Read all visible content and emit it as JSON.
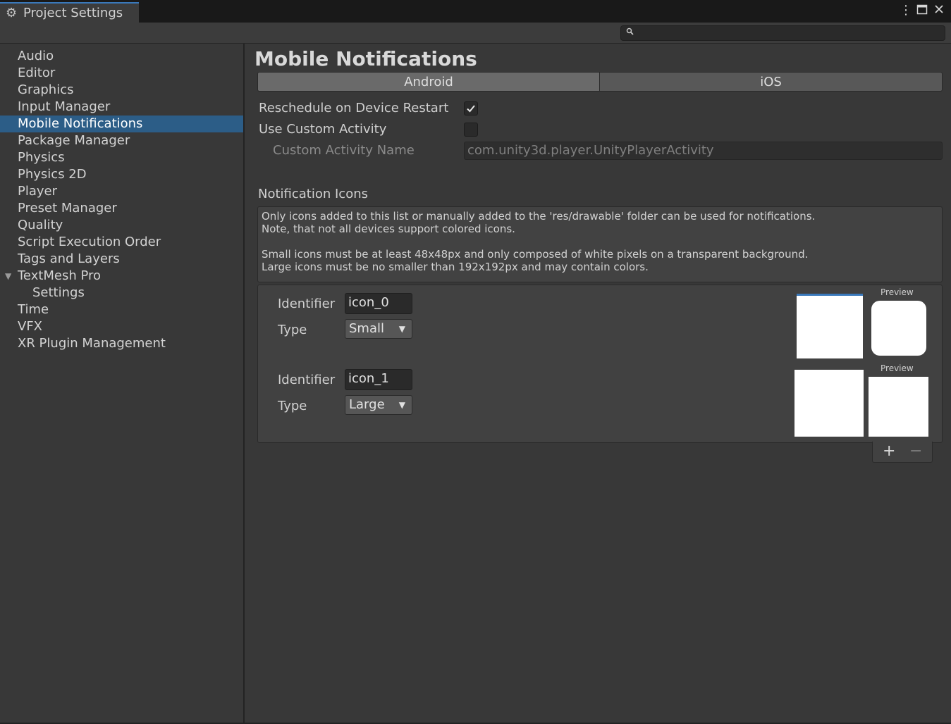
{
  "window": {
    "tab_title": "Project Settings",
    "tab_icon": "gear-icon",
    "controls": [
      "more-vertical-icon",
      "maximize-icon",
      "close-icon"
    ]
  },
  "search": {
    "placeholder": "",
    "icon": "search-icon"
  },
  "sidebar": {
    "items": [
      {
        "label": "Audio"
      },
      {
        "label": "Editor"
      },
      {
        "label": "Graphics"
      },
      {
        "label": "Input Manager"
      },
      {
        "label": "Mobile Notifications",
        "selected": true
      },
      {
        "label": "Package Manager"
      },
      {
        "label": "Physics"
      },
      {
        "label": "Physics 2D"
      },
      {
        "label": "Player"
      },
      {
        "label": "Preset Manager"
      },
      {
        "label": "Quality"
      },
      {
        "label": "Script Execution Order"
      },
      {
        "label": "Tags and Layers"
      },
      {
        "label": "TextMesh Pro",
        "expanded": true
      },
      {
        "label": "Settings"
      },
      {
        "label": "Time"
      },
      {
        "label": "VFX"
      },
      {
        "label": "XR Plugin Management"
      }
    ]
  },
  "main": {
    "title": "Mobile Notifications",
    "tabs": [
      {
        "label": "Android",
        "active": true
      },
      {
        "label": "iOS",
        "active": false
      }
    ],
    "settings": {
      "reschedule_label": "Reschedule on Device Restart",
      "reschedule_checked": true,
      "custom_activity_label": "Use Custom Activity",
      "custom_activity_checked": false,
      "activity_name_label": "Custom Activity Name",
      "activity_name_value": "com.unity3d.player.UnityPlayerActivity"
    },
    "icons_section": {
      "title": "Notification Icons",
      "help_lines": [
        "Only icons added to this list or manually added to the 'res/drawable' folder can be used for notifications.",
        "Note, that not all devices support colored icons.",
        "",
        "Small icons must be at least 48x48px and only composed of white pixels on a transparent background.",
        "Large icons must be no smaller than 192x192px and may contain colors."
      ],
      "entries": [
        {
          "identifier_label": "Identifier",
          "identifier": "icon_0",
          "type_label": "Type",
          "type": "Small",
          "preview_label": "Preview"
        },
        {
          "identifier_label": "Identifier",
          "identifier": "icon_1",
          "type_label": "Type",
          "type": "Large",
          "preview_label": "Preview"
        }
      ],
      "add_symbol": "+",
      "remove_symbol": "−"
    }
  },
  "colors": {
    "background": "#383838",
    "selection": "#2c5d87",
    "accent": "#3a79bb"
  }
}
